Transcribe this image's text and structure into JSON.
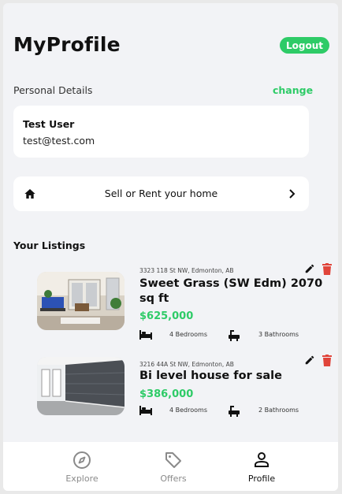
{
  "header": {
    "title": "MyProfile",
    "logout_label": "Logout"
  },
  "personal_details": {
    "section_label": "Personal Details",
    "change_label": "change",
    "name": "Test User",
    "email": "test@test.com"
  },
  "sell_rent": {
    "label": "Sell or Rent your home",
    "icon": "home-icon",
    "chevron": "chevron-right-icon"
  },
  "listings": {
    "heading": "Your Listings",
    "items": [
      {
        "address": "3323 118 St NW, Edmonton, AB",
        "title": "Sweet Grass (SW Edm) 2070 sq ft",
        "price": "$625,000",
        "bedrooms": "4 Bedrooms",
        "bathrooms": "3 Bathrooms"
      },
      {
        "address": "3216 44A St NW, Edmonton, AB",
        "title": "Bi level house for sale",
        "price": "$386,000",
        "bedrooms": "4 Bedrooms",
        "bathrooms": "2 Bathrooms"
      }
    ]
  },
  "bottom_nav": {
    "items": [
      {
        "label": "Explore",
        "icon": "compass-icon",
        "active": false
      },
      {
        "label": "Offers",
        "icon": "tag-icon",
        "active": false
      },
      {
        "label": "Profile",
        "icon": "person-icon",
        "active": true
      }
    ]
  },
  "colors": {
    "accent": "#2ecb67",
    "background": "#f2f3f6",
    "delete": "#e0443a",
    "inactive": "#8a8a8a"
  }
}
